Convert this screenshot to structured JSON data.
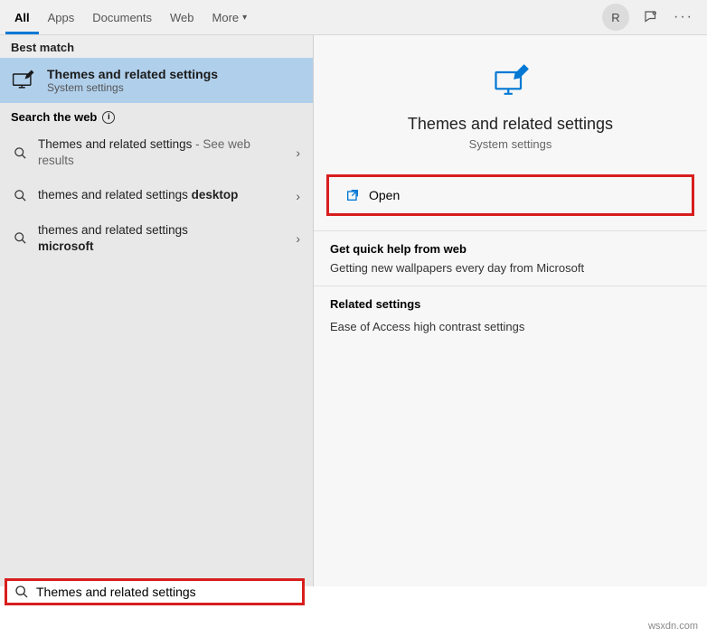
{
  "tabs": {
    "all": "All",
    "apps": "Apps",
    "documents": "Documents",
    "web": "Web",
    "more": "More"
  },
  "avatar_initial": "R",
  "left": {
    "best_match_header": "Best match",
    "best_match": {
      "title": "Themes and related settings",
      "subtitle": "System settings"
    },
    "search_web_header": "Search the web",
    "results": [
      {
        "plain": "Themes and related settings",
        "suffix": " - See web results",
        "bold": ""
      },
      {
        "plain": "themes and related settings ",
        "suffix": "",
        "bold": "desktop"
      },
      {
        "plain": "themes and related settings ",
        "suffix": "",
        "bold": "microsoft"
      }
    ]
  },
  "right": {
    "title": "Themes and related settings",
    "subtitle": "System settings",
    "open_label": "Open",
    "quick_help_header": "Get quick help from web",
    "quick_help_body": "Getting new wallpapers every day from Microsoft",
    "related_header": "Related settings",
    "related_link": "Ease of Access high contrast settings"
  },
  "search": {
    "value": "Themes and related settings"
  },
  "watermark": "wsxdn.com"
}
